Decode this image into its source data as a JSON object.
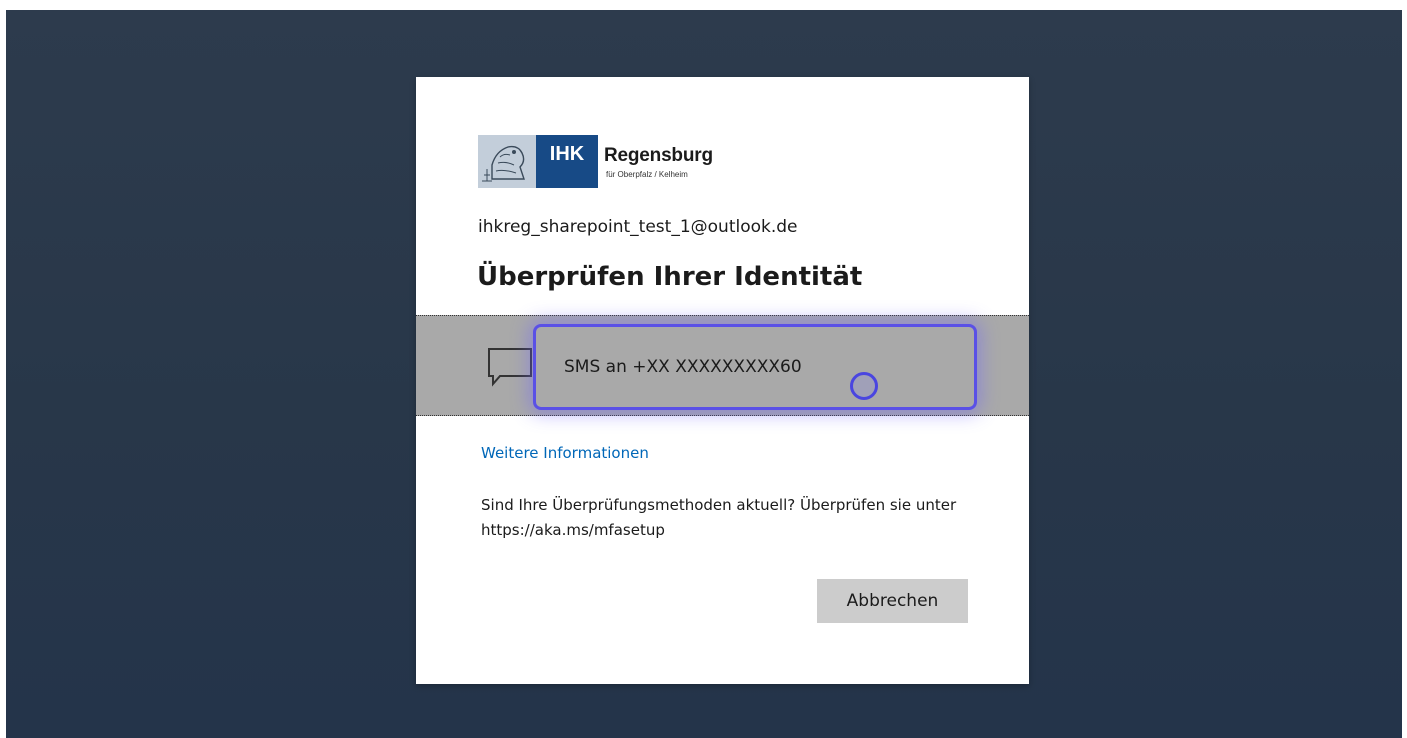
{
  "brand": {
    "logo_mark": "IHK",
    "logo_name": "Regensburg",
    "logo_subtitle": "für Oberpfalz / Kelheim",
    "mark_color": "#174a86"
  },
  "account": {
    "email": "ihkreg_sharepoint_test_1@outlook.de"
  },
  "heading": "Überprüfen Ihrer Identität",
  "verification_option": {
    "icon": "chat-bubble-icon",
    "label": "SMS an +XX XXXXXXXXX60",
    "highlight_color": "#5a50e6"
  },
  "links": {
    "more_info": "Weitere Informationen"
  },
  "hint_text": "Sind Ihre Überprüfungsmethoden aktuell? Überprüfen sie unter https://aka.ms/mfasetup",
  "buttons": {
    "cancel": "Abbrechen"
  }
}
